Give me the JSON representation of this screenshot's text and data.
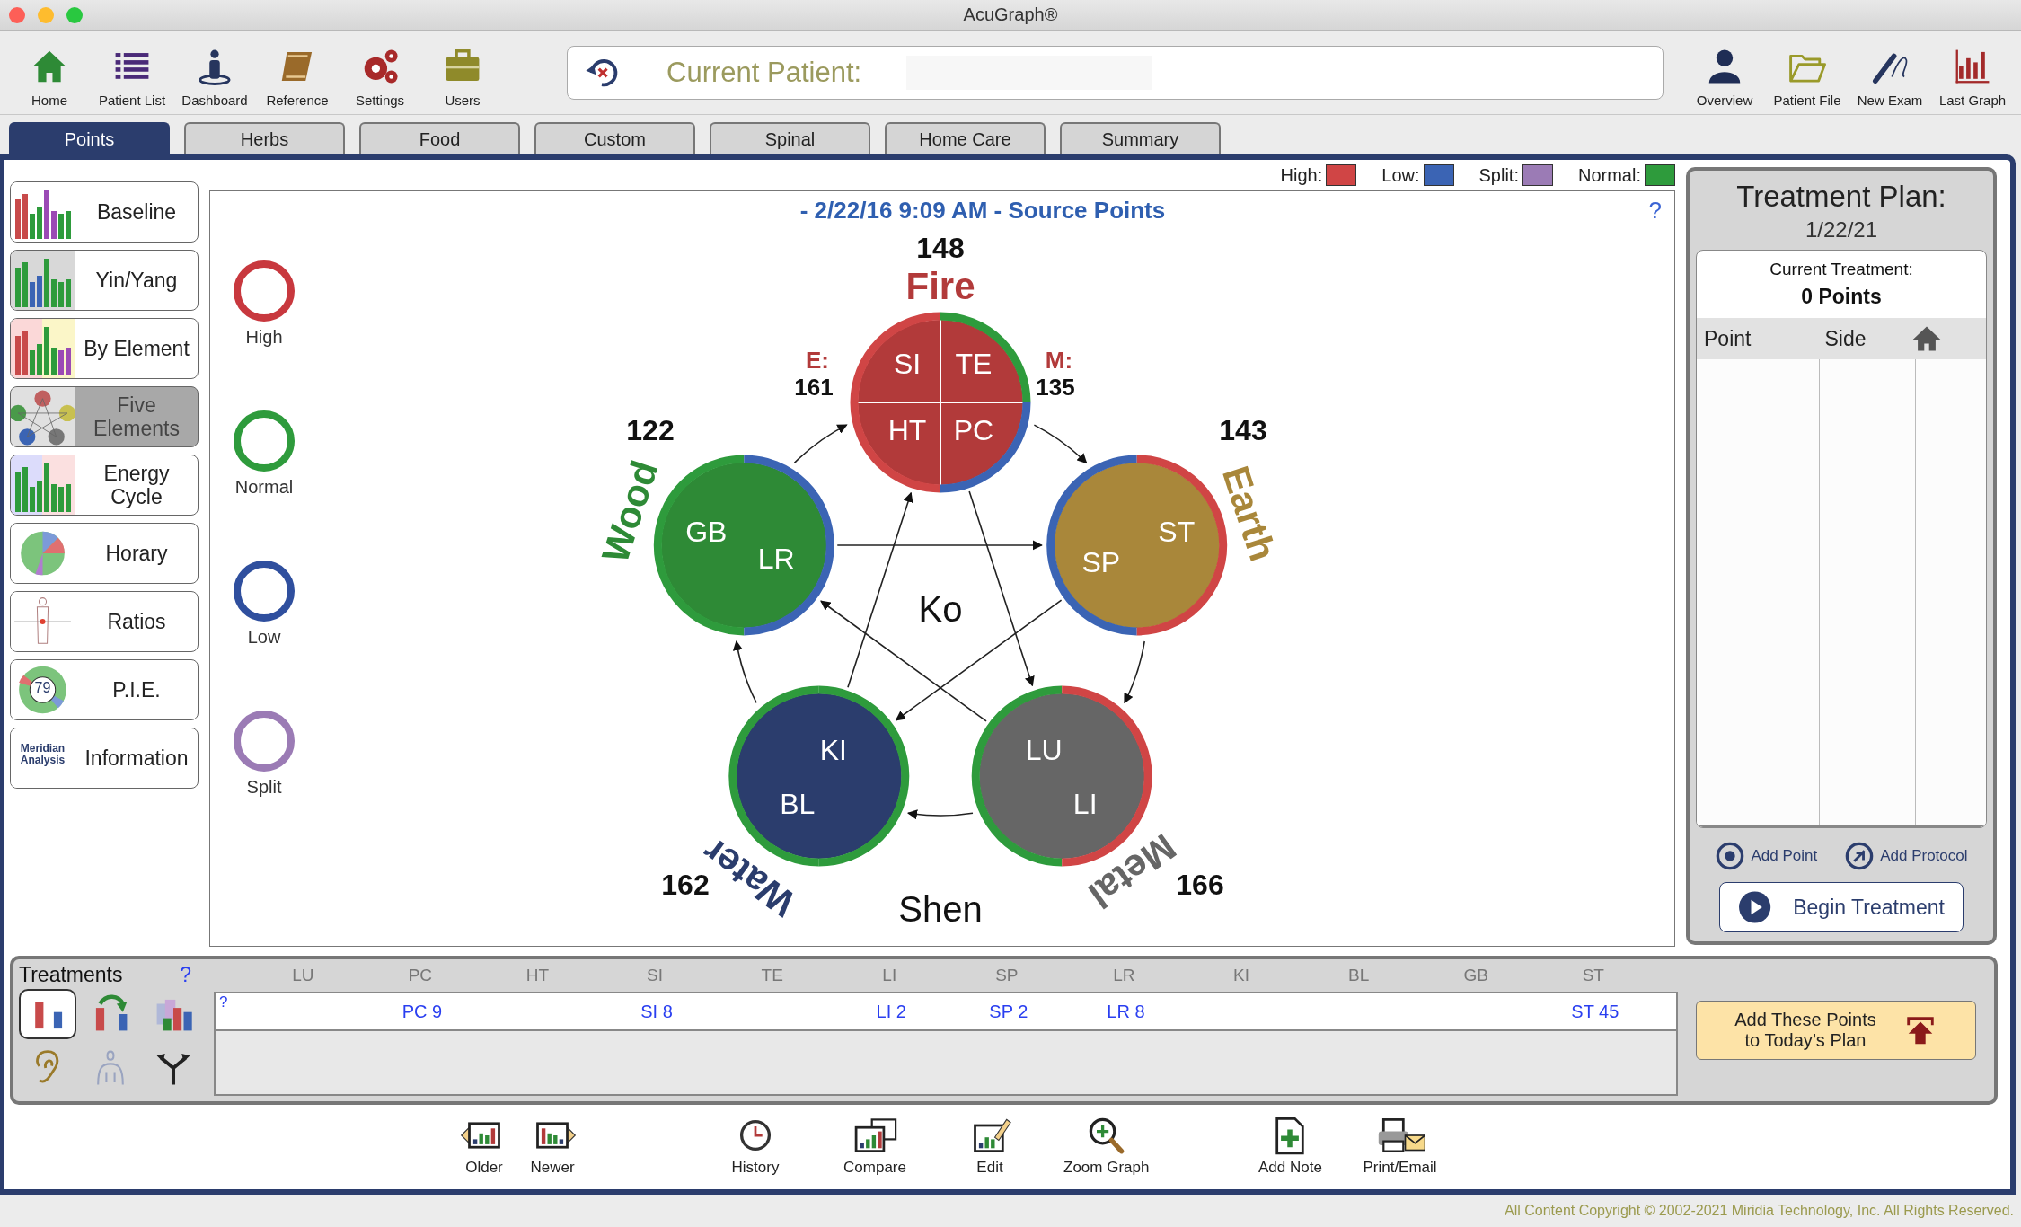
{
  "window": {
    "title": "AcuGraph®"
  },
  "toolbar_left": [
    {
      "label": "Home"
    },
    {
      "label": "Patient List"
    },
    {
      "label": "Dashboard"
    },
    {
      "label": "Reference"
    },
    {
      "label": "Settings"
    },
    {
      "label": "Users"
    }
  ],
  "patient": {
    "label": "Current Patient:"
  },
  "toolbar_right": [
    {
      "label": "Overview"
    },
    {
      "label": "Patient File"
    },
    {
      "label": "New Exam"
    },
    {
      "label": "Last Graph"
    }
  ],
  "tabs": [
    {
      "label": "Points",
      "selected": true
    },
    {
      "label": "Herbs",
      "selected": false
    },
    {
      "label": "Food",
      "selected": false
    },
    {
      "label": "Custom",
      "selected": false
    },
    {
      "label": "Spinal",
      "selected": false
    },
    {
      "label": "Home Care",
      "selected": false
    },
    {
      "label": "Summary",
      "selected": false
    }
  ],
  "sidebar": [
    {
      "label": "Baseline",
      "selected": false
    },
    {
      "label": "Yin/Yang",
      "selected": false
    },
    {
      "label": "By Element",
      "selected": false
    },
    {
      "label": "Five Elements",
      "selected": true
    },
    {
      "label": "Energy Cycle",
      "selected": false
    },
    {
      "label": "Horary",
      "selected": false
    },
    {
      "label": "Ratios",
      "selected": false
    },
    {
      "label": "P.I.E.",
      "selected": false,
      "thumb_text": "79"
    },
    {
      "label": "Information",
      "selected": false,
      "thumb_text": "Meridian Analysis"
    }
  ],
  "legend": [
    {
      "label": "High:",
      "color": "#d04545"
    },
    {
      "label": "Low:",
      "color": "#3b64b4"
    },
    {
      "label": "Split:",
      "color": "#9b7bb5"
    },
    {
      "label": "Normal:",
      "color": "#2e9b3c"
    }
  ],
  "chart": {
    "title": "- 2/22/16 9:09 AM - Source Points",
    "help": "?",
    "ring_legend": [
      {
        "label": "High",
        "color": "#c8383e"
      },
      {
        "label": "Normal",
        "color": "#2e9b3c"
      },
      {
        "label": "Low",
        "color": "#2f4f9e"
      },
      {
        "label": "Split",
        "color": "#9b7bb5"
      }
    ],
    "elements": [
      {
        "name": "Fire",
        "value": "148",
        "color": "#b23a3a",
        "meridians": [
          {
            "label": "SI",
            "color": "#d04545"
          },
          {
            "label": "TE",
            "color": "#2e9b3c"
          },
          {
            "label": "HT",
            "color": "#d04545"
          },
          {
            "label": "PC",
            "color": "#3b64b4"
          }
        ]
      },
      {
        "name": "Earth",
        "value": "143",
        "color": "#a9873a",
        "meridians": [
          {
            "label": "SP",
            "color": "#3b64b4"
          },
          {
            "label": "ST",
            "color": "#d04545"
          }
        ]
      },
      {
        "name": "Metal",
        "value": "166",
        "color": "#666666",
        "meridians": [
          {
            "label": "LU",
            "color": "#2e9b3c"
          },
          {
            "label": "LI",
            "color": "#d04545"
          }
        ]
      },
      {
        "name": "Water",
        "value": "162",
        "color": "#2b3d6d",
        "meridians": [
          {
            "label": "BL",
            "color": "#2e9b3c"
          },
          {
            "label": "KI",
            "color": "#2e9b3c"
          }
        ]
      },
      {
        "name": "Wood",
        "value": "122",
        "color": "#2e8a36",
        "meridians": [
          {
            "label": "GB",
            "color": "#2e9b3c"
          },
          {
            "label": "LR",
            "color": "#3b64b4"
          }
        ]
      }
    ],
    "fire_notes": [
      {
        "label": "E:",
        "value": "161"
      },
      {
        "label": "M:",
        "value": "135"
      }
    ],
    "center_label": "Ko",
    "bottom_label": "Shen"
  },
  "treatment_plan": {
    "title": "Treatment Plan:",
    "date": "1/22/21",
    "current_label": "Current Treatment:",
    "count": "0 Points",
    "columns": [
      "Point",
      "Side"
    ],
    "add_point": "Add Point",
    "add_protocol": "Add Protocol",
    "begin": "Begin Treatment"
  },
  "treatments": {
    "title": "Treatments",
    "help": "?",
    "row_help": "?",
    "tools": [
      {
        "selected": true
      },
      {
        "selected": false
      },
      {
        "selected": false
      },
      {
        "selected": false
      },
      {
        "selected": false
      },
      {
        "selected": false
      }
    ],
    "columns": [
      {
        "label": "LU"
      },
      {
        "label": "PC",
        "point": "PC 9"
      },
      {
        "label": "HT"
      },
      {
        "label": "SI",
        "point": "SI 8"
      },
      {
        "label": "TE"
      },
      {
        "label": "LI",
        "point": "LI 2"
      },
      {
        "label": "SP",
        "point": "SP 2"
      },
      {
        "label": "LR",
        "point": "LR 8"
      },
      {
        "label": "KI"
      },
      {
        "label": "BL"
      },
      {
        "label": "GB"
      },
      {
        "label": "ST",
        "point": "ST 45"
      }
    ],
    "add_button": [
      "Add These Points",
      "to Today’s Plan"
    ]
  },
  "actions": [
    {
      "label": "Older"
    },
    {
      "label": "Newer"
    },
    {
      "label": "History"
    },
    {
      "label": "Compare"
    },
    {
      "label": "Edit"
    },
    {
      "label": "Zoom Graph"
    },
    {
      "label": "Add Note"
    },
    {
      "label": "Print/Email"
    }
  ],
  "footer": "All Content Copyright © 2002-2021 Miridia Technology, Inc.  All Rights Reserved."
}
